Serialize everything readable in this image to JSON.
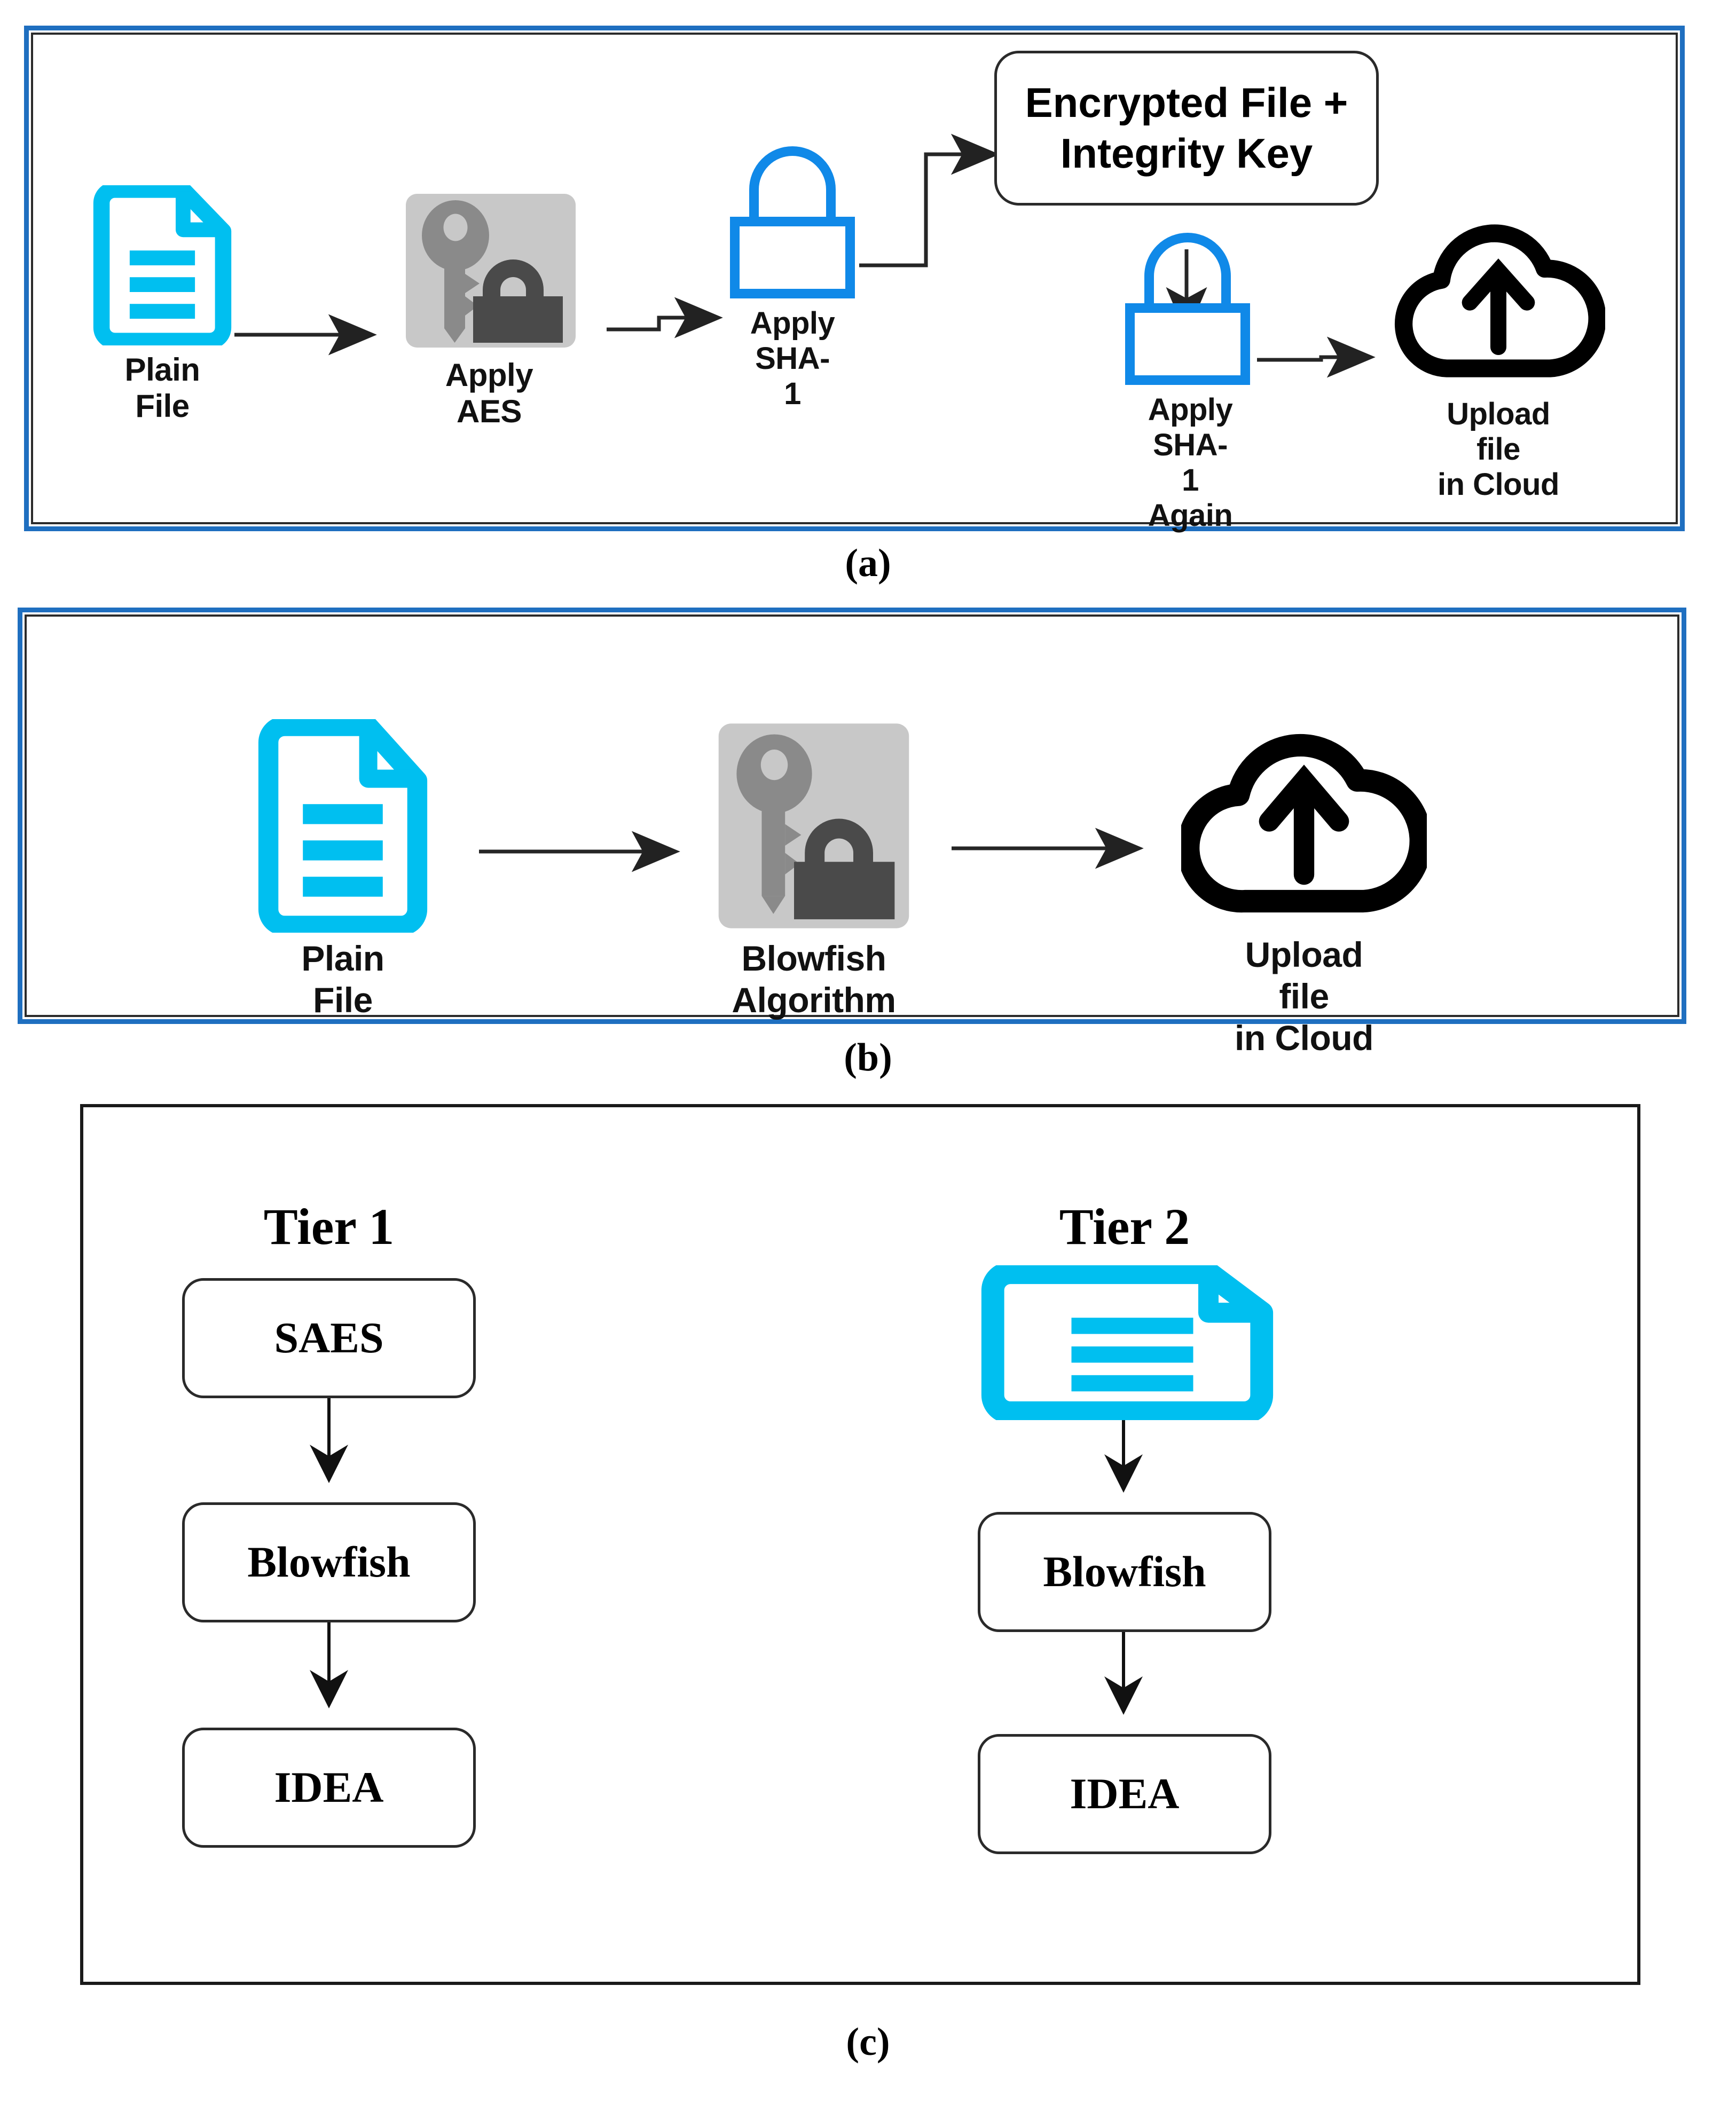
{
  "figure": {
    "panels": [
      {
        "id": "a",
        "caption": "(a)",
        "border_color": "#1f6fc0",
        "nodes": [
          {
            "key": "plain_file",
            "label": "Plain\nFile",
            "icon": "file-document-icon"
          },
          {
            "key": "apply_aes",
            "label": "Apply\nAES",
            "icon": "key-padlock-icon"
          },
          {
            "key": "apply_sha1",
            "label": "Apply\nSHA-1",
            "icon": "padlock-outline-icon"
          },
          {
            "key": "encrypted",
            "label": "Encrypted File +\nIntegrity Key",
            "icon": "rounded-box"
          },
          {
            "key": "sha1_again",
            "label": "Apply SHA-1\nAgain",
            "icon": "padlock-outline-icon"
          },
          {
            "key": "upload_cloud",
            "label": "Upload file\nin Cloud",
            "icon": "cloud-upload-icon"
          }
        ]
      },
      {
        "id": "b",
        "caption": "(b)",
        "border_color": "#1f6fc0",
        "nodes": [
          {
            "key": "plain_file",
            "label": "Plain\nFile",
            "icon": "file-document-icon"
          },
          {
            "key": "blowfish",
            "label": "Blowfish\nAlgorithm",
            "icon": "key-padlock-icon"
          },
          {
            "key": "upload_cloud",
            "label": "Upload file\nin Cloud",
            "icon": "cloud-upload-icon"
          }
        ]
      },
      {
        "id": "c",
        "caption": "(c)",
        "border_color": "#1a1a1a",
        "tiers": [
          {
            "key": "tier1",
            "heading": "Tier 1",
            "steps": [
              {
                "key": "saes",
                "label": "SAES",
                "icon": "rounded-box"
              },
              {
                "key": "blowfish",
                "label": "Blowfish",
                "icon": "rounded-box"
              },
              {
                "key": "idea",
                "label": "IDEA",
                "icon": "rounded-box"
              }
            ]
          },
          {
            "key": "tier2",
            "heading": "Tier 2",
            "steps": [
              {
                "key": "plain_file",
                "label": "",
                "icon": "file-document-icon"
              },
              {
                "key": "blowfish",
                "label": "Blowfish",
                "icon": "rounded-box"
              },
              {
                "key": "idea",
                "label": "IDEA",
                "icon": "rounded-box"
              }
            ]
          }
        ]
      }
    ]
  },
  "colors": {
    "panel_border_blue": "#1f6fc0",
    "file_icon_cyan": "#00bff0",
    "padlock_blue": "#1089e8",
    "tile_gray": "#c8c8c8",
    "key_gray": "#8a8a8a",
    "lock_dark_gray": "#4a4a4a",
    "cloud_black": "#000000",
    "arrow_black": "#262626",
    "text_black": "#111111"
  }
}
